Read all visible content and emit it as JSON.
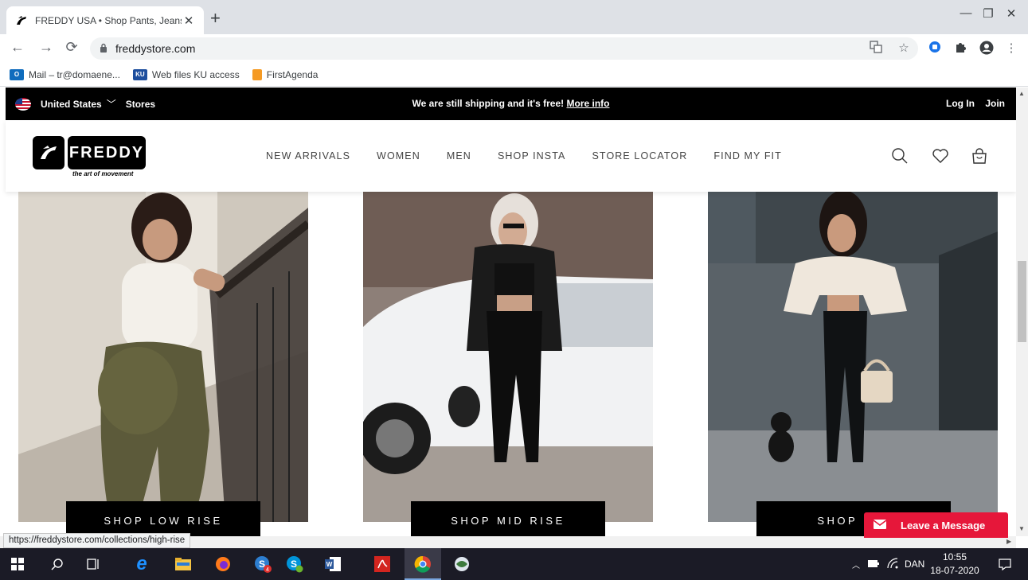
{
  "browser": {
    "tab_title": "FREDDY USA • Shop Pants, Jeans",
    "url": "freddystore.com",
    "status_url": "https://freddystore.com/collections/high-rise",
    "bookmarks": [
      {
        "label": "Mail – tr@domaene...",
        "icon_color": "#0f6cbd"
      },
      {
        "label": "Web files KU access",
        "icon_color": "#1d4e9e"
      },
      {
        "label": "FirstAgenda",
        "icon_color": "#f59a23"
      }
    ]
  },
  "site": {
    "topbar": {
      "country": "United States",
      "stores": "Stores",
      "promo": "We are still shipping and it's free!",
      "promo_link": "More info",
      "login": "Log In",
      "join": "Join"
    },
    "logo": {
      "wordmark": "FREDDY",
      "tagline": "the art of movement"
    },
    "nav": [
      "NEW ARRIVALS",
      "WOMEN",
      "MEN",
      "SHOP INSTA",
      "STORE LOCATOR",
      "FIND MY FIT"
    ],
    "collections": [
      {
        "button": "SHOP LOW RISE"
      },
      {
        "button": "SHOP MID RISE"
      },
      {
        "button": "SHOP HIG"
      }
    ],
    "chat_widget": "Leave a Message"
  },
  "taskbar": {
    "language": "DAN",
    "time": "10:55",
    "date": "18-07-2020"
  }
}
